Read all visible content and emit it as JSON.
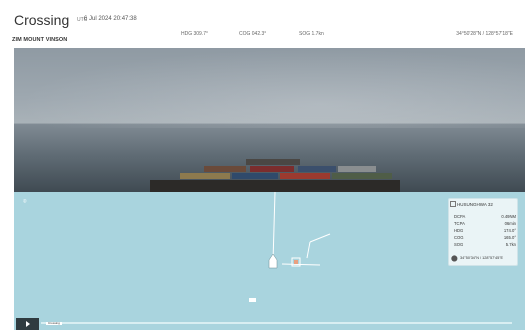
{
  "header": {
    "title": "Crossing",
    "timezone": "UTC",
    "datetime": "6 Jul 2024 20:47:38",
    "vessel_name": "ZIM MOUNT VINSON",
    "metrics": {
      "hdg": "HDG  309.7°",
      "cog": "COG  042.3°",
      "sog": "SOG  1.7kn",
      "position": "34°50'28\"N / 128°57'18\"E"
    }
  },
  "target_card": {
    "name": "HUSUNGHWA 32",
    "rows": [
      {
        "k": "DCPA",
        "v": "0.49NM"
      },
      {
        "k": "TCPA",
        "v": "06min"
      },
      {
        "k": "HDG",
        "v": "174.0°"
      },
      {
        "k": "COG",
        "v": "165.0°"
      },
      {
        "k": "SOG",
        "v": "5.7kn"
      }
    ],
    "position": "34°50'34\"N / 128°57'45\"E"
  },
  "timeline": {
    "label": "Crossing",
    "progress": 0.0
  },
  "icons": {
    "compass": "compass-icon",
    "target": "target-frame-icon",
    "pin": "location-pin-icon",
    "play": "play-icon"
  },
  "colors": {
    "chart_water": "#a9d4de",
    "card_bg": "#eaf4f6",
    "play_bg": "#2f3b40"
  }
}
